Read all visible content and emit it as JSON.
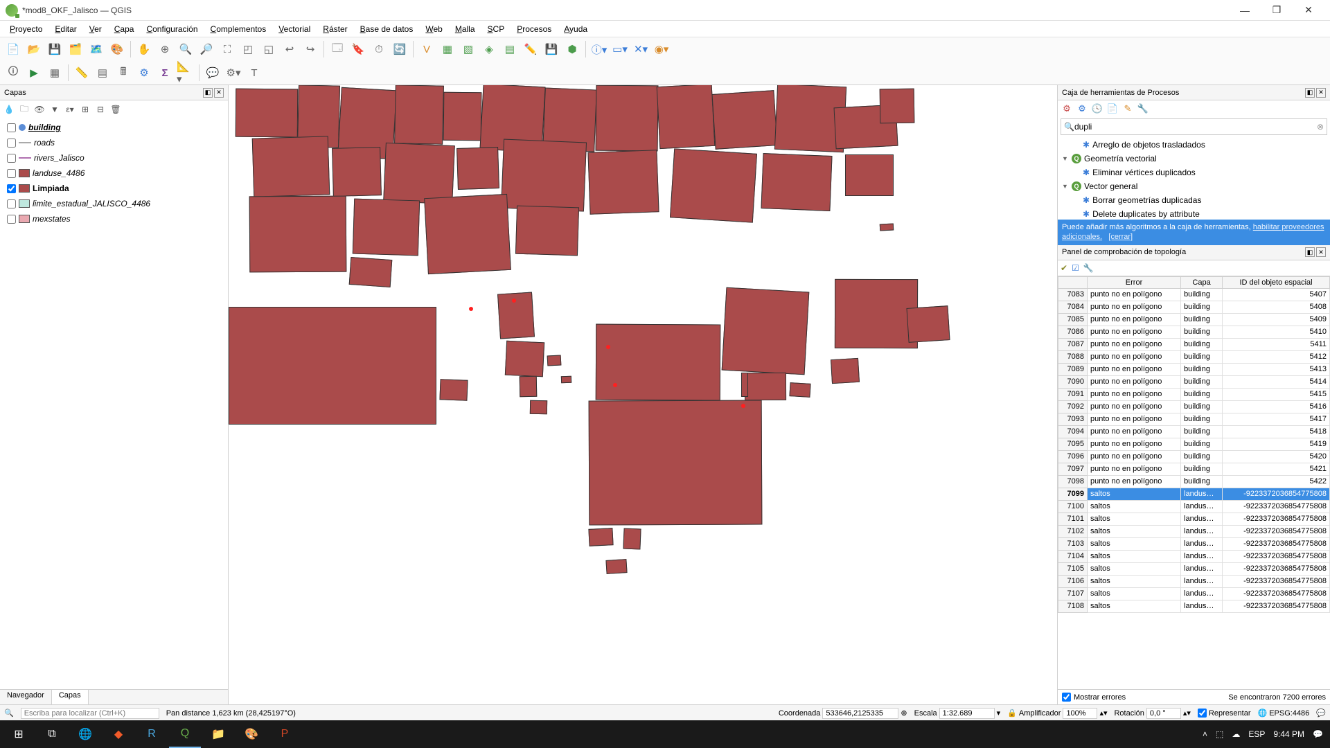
{
  "window": {
    "title": "*mod8_OKF_Jalisco — QGIS"
  },
  "menu": [
    "Proyecto",
    "Editar",
    "Ver",
    "Capa",
    "Configuración",
    "Complementos",
    "Vectorial",
    "Ráster",
    "Base de datos",
    "Web",
    "Malla",
    "SCP",
    "Procesos",
    "Ayuda"
  ],
  "layers_panel": {
    "title": "Capas",
    "items": [
      {
        "name": "building",
        "checked": false,
        "style": "point",
        "color": "#5b8dd6",
        "bold": true,
        "italic": true,
        "underline": true
      },
      {
        "name": "roads",
        "checked": false,
        "style": "line",
        "color": "#aaaaaa",
        "italic": true
      },
      {
        "name": "rivers_Jalisco",
        "checked": false,
        "style": "line",
        "color": "#b070b0",
        "italic": true
      },
      {
        "name": "landuse_4486",
        "checked": false,
        "style": "poly",
        "color": "#aa4b4b",
        "italic": true
      },
      {
        "name": "Limpiada",
        "checked": true,
        "style": "poly",
        "color": "#aa4b4b",
        "bold": true
      },
      {
        "name": "limite_estadual_JALISCO_4486",
        "checked": false,
        "style": "poly",
        "color": "#bfe8df",
        "italic": true
      },
      {
        "name": "mexstates",
        "checked": false,
        "style": "poly",
        "color": "#e9a8b0",
        "italic": true
      }
    ],
    "tabs": [
      "Navegador",
      "Capas"
    ],
    "active_tab": 1
  },
  "processing": {
    "title": "Caja de herramientas de Procesos",
    "search": "dupli",
    "tree": [
      {
        "label": "Arreglo de objetos trasladados",
        "type": "alg",
        "indent": 1
      },
      {
        "label": "Geometría vectorial",
        "type": "group",
        "indent": 0
      },
      {
        "label": "Eliminar vértices duplicados",
        "type": "alg",
        "indent": 1
      },
      {
        "label": "Vector general",
        "type": "group",
        "indent": 0
      },
      {
        "label": "Borrar geometrías duplicadas",
        "type": "alg",
        "indent": 1
      },
      {
        "label": "Delete duplicates by attribute",
        "type": "alg",
        "indent": 1
      }
    ],
    "banner_text": "Puede añadir más algoritmos a la caja de herramientas,",
    "banner_link1": "habilitar proveedores adicionales.",
    "banner_link2": "[cerrar]"
  },
  "topology": {
    "title": "Panel de comprobación de topología",
    "cols": [
      "Error",
      "Capa",
      "ID del objeto espacial"
    ],
    "rows": [
      {
        "n": 7083,
        "err": "punto no en polígono",
        "layer": "building",
        "id": "5407"
      },
      {
        "n": 7084,
        "err": "punto no en polígono",
        "layer": "building",
        "id": "5408"
      },
      {
        "n": 7085,
        "err": "punto no en polígono",
        "layer": "building",
        "id": "5409"
      },
      {
        "n": 7086,
        "err": "punto no en polígono",
        "layer": "building",
        "id": "5410"
      },
      {
        "n": 7087,
        "err": "punto no en polígono",
        "layer": "building",
        "id": "5411"
      },
      {
        "n": 7088,
        "err": "punto no en polígono",
        "layer": "building",
        "id": "5412"
      },
      {
        "n": 7089,
        "err": "punto no en polígono",
        "layer": "building",
        "id": "5413"
      },
      {
        "n": 7090,
        "err": "punto no en polígono",
        "layer": "building",
        "id": "5414"
      },
      {
        "n": 7091,
        "err": "punto no en polígono",
        "layer": "building",
        "id": "5415"
      },
      {
        "n": 7092,
        "err": "punto no en polígono",
        "layer": "building",
        "id": "5416"
      },
      {
        "n": 7093,
        "err": "punto no en polígono",
        "layer": "building",
        "id": "5417"
      },
      {
        "n": 7094,
        "err": "punto no en polígono",
        "layer": "building",
        "id": "5418"
      },
      {
        "n": 7095,
        "err": "punto no en polígono",
        "layer": "building",
        "id": "5419"
      },
      {
        "n": 7096,
        "err": "punto no en polígono",
        "layer": "building",
        "id": "5420"
      },
      {
        "n": 7097,
        "err": "punto no en polígono",
        "layer": "building",
        "id": "5421"
      },
      {
        "n": 7098,
        "err": "punto no en polígono",
        "layer": "building",
        "id": "5422"
      },
      {
        "n": 7099,
        "err": "saltos",
        "layer": "landus…",
        "id": "-9223372036854775808",
        "sel": true
      },
      {
        "n": 7100,
        "err": "saltos",
        "layer": "landus…",
        "id": "-9223372036854775808"
      },
      {
        "n": 7101,
        "err": "saltos",
        "layer": "landus…",
        "id": "-9223372036854775808"
      },
      {
        "n": 7102,
        "err": "saltos",
        "layer": "landus…",
        "id": "-9223372036854775808"
      },
      {
        "n": 7103,
        "err": "saltos",
        "layer": "landus…",
        "id": "-9223372036854775808"
      },
      {
        "n": 7104,
        "err": "saltos",
        "layer": "landus…",
        "id": "-9223372036854775808"
      },
      {
        "n": 7105,
        "err": "saltos",
        "layer": "landus…",
        "id": "-9223372036854775808"
      },
      {
        "n": 7106,
        "err": "saltos",
        "layer": "landus…",
        "id": "-9223372036854775808"
      },
      {
        "n": 7107,
        "err": "saltos",
        "layer": "landus…",
        "id": "-9223372036854775808"
      },
      {
        "n": 7108,
        "err": "saltos",
        "layer": "landus…",
        "id": "-9223372036854775808"
      }
    ],
    "show_errors_label": "Mostrar errores",
    "count_label": "Se encontraron 7200 errores"
  },
  "status": {
    "locator_placeholder": "Escriba para localizar (Ctrl+K)",
    "pan_distance": "Pan distance 1,623 km (28,425197°O)",
    "coord_label": "Coordenada",
    "coord_value": "533646,2125335",
    "scale_label": "Escala",
    "scale_value": "1:32.689",
    "magnifier_label": "Amplificador",
    "magnifier_value": "100%",
    "rotation_label": "Rotación",
    "rotation_value": "0,0 °",
    "render_label": "Representar",
    "crs": "EPSG:4486"
  },
  "taskbar": {
    "lang": "ESP",
    "time": "9:44 PM"
  }
}
